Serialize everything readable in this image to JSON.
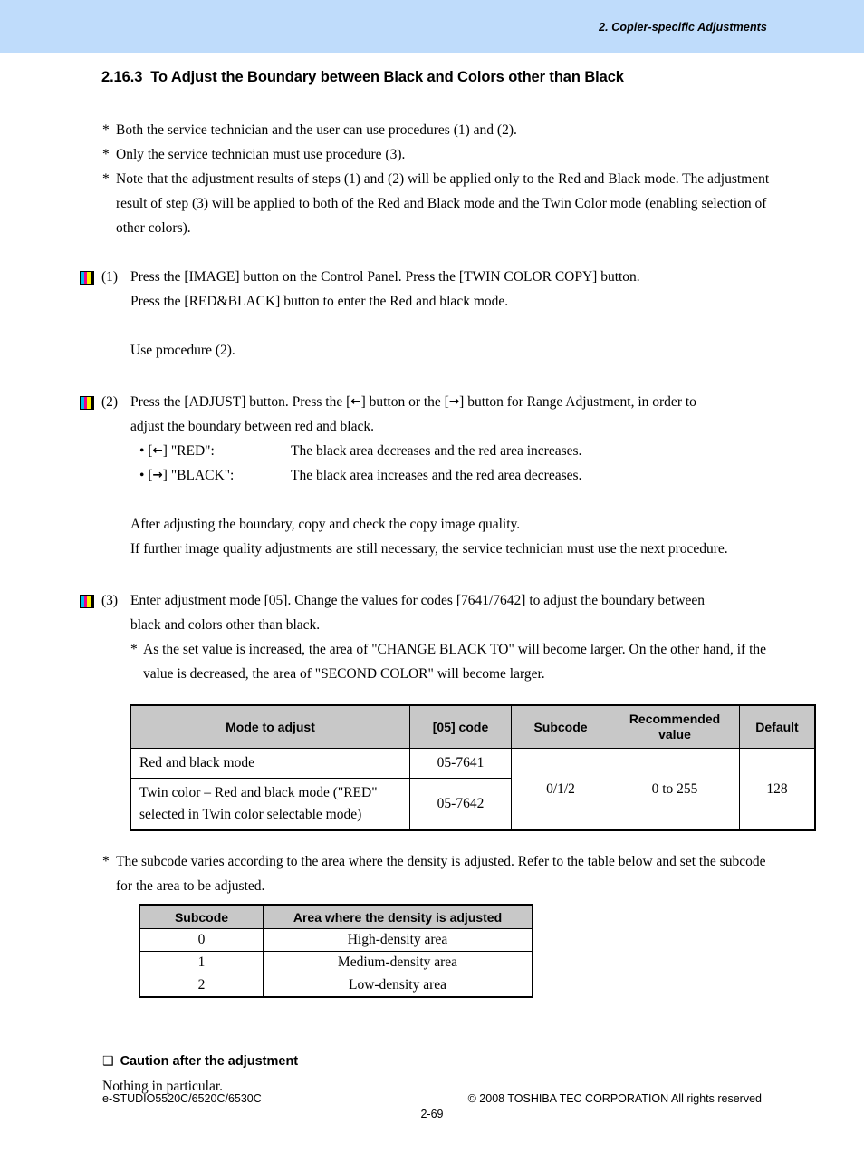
{
  "header": {
    "running_head": "2. Copier-specific Adjustments"
  },
  "section": {
    "number": "2.16.3",
    "title": "To Adjust the Boundary between Black and Colors other than Black"
  },
  "intro_notes": [
    "Both the service technician and the user can use procedures (1) and (2).",
    "Only the service technician must use procedure (3).",
    "Note that the adjustment results of steps (1) and (2) will be applied only to the Red and Black mode. The adjustment result of step (3) will be applied to both of the Red and Black mode and the Twin Color mode (enabling selection of other colors)."
  ],
  "steps": {
    "step1": {
      "marker": "cmyk-bar-icon",
      "number": "(1)",
      "line1": "Press the [IMAGE] button on the Control Panel.  Press the [TWIN COLOR COPY] button.",
      "line2": "Press the [RED&BLACK] button to enter the Red and black mode.",
      "followup": "Use procedure (2)."
    },
    "step2": {
      "marker": "cmyk-bar-icon",
      "number": "(2)",
      "line1_a": "Press the [ADJUST] button.  Press the [",
      "arrow_left": "←",
      "line1_b": "] button or the [",
      "arrow_right": "→",
      "line1_c": "] button for Range Adjustment, in order to",
      "line2": "adjust the boundary between red and black.",
      "bullets": [
        {
          "bullet": "•",
          "key_pre": "[",
          "arrow": "←",
          "key_post": "] \"RED\":",
          "value": "The black area decreases and the red area increases."
        },
        {
          "bullet": "•",
          "key_pre": "[",
          "arrow": "→",
          "key_post": "] \"BLACK\":",
          "value": "The black area increases and the red area decreases."
        }
      ],
      "after1": "After adjusting the boundary, copy and check the copy image quality.",
      "after2": "If further image quality adjustments are still necessary, the service technician must use the next procedure."
    },
    "step3": {
      "marker": "cmyk-bar-icon",
      "number": "(3)",
      "line1": "Enter adjustment mode [05].  Change the values for codes [7641/7642] to adjust the boundary between",
      "line2": "black and colors other than black.",
      "note": "As the set value is increased, the area of \"CHANGE BLACK TO\" will become larger.  On the other hand, if the value is decreased, the area of \"SECOND COLOR\" will become larger."
    }
  },
  "main_table": {
    "headers": [
      "Mode to adjust",
      "[05] code",
      "Subcode",
      "Recommended value",
      "Default"
    ],
    "rows": [
      {
        "mode": "Red and black mode",
        "code": "05-7641",
        "subcode": "0/1/2",
        "recommended": "0 to 255",
        "default": "128"
      },
      {
        "mode": "Twin color – Red and black mode (\"RED\" selected in Twin color selectable mode)",
        "code": "05-7642"
      }
    ]
  },
  "subcode_note": "The subcode varies according to the area where the density is adjusted.  Refer to the table below and set the subcode for the area to be adjusted.",
  "subcode_table": {
    "headers": [
      "Subcode",
      "Area where the density is adjusted"
    ],
    "rows": [
      {
        "subcode": "0",
        "area": "High-density area"
      },
      {
        "subcode": "1",
        "area": "Medium-density area"
      },
      {
        "subcode": "2",
        "area": "Low-density area"
      }
    ]
  },
  "caution": {
    "box_glyph": "❑",
    "heading": "Caution after the adjustment",
    "body": "Nothing in particular."
  },
  "footer": {
    "model": "e-STUDIO5520C/6520C/6530C",
    "copyright": "© 2008 TOSHIBA TEC CORPORATION All rights reserved",
    "page": "2-69"
  },
  "colors": {
    "header_band": "#bfdcfb",
    "table_header": "#c8c8c8",
    "cyan": "#00c0f0",
    "magenta": "#ec008c",
    "yellow": "#fff200",
    "black": "#000000"
  }
}
